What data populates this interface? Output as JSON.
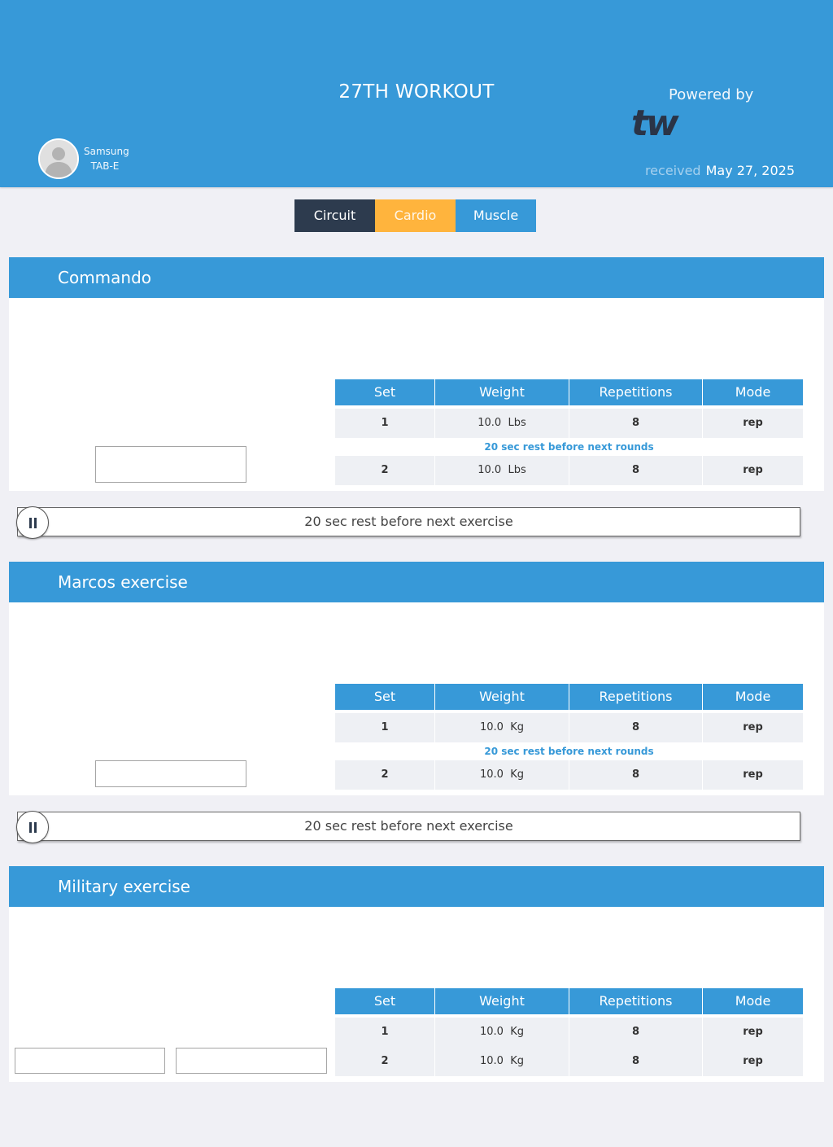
{
  "header": {
    "title": "27TH WORKOUT",
    "device_line1": "Samsung",
    "device_line2": "TAB-E",
    "powered_by": "Powered by",
    "logo_text": "tw",
    "received_label": "received",
    "received_date": "May 27, 2025"
  },
  "tabs": [
    {
      "label": "Circuit",
      "color": "#2d3b4e"
    },
    {
      "label": "Cardio",
      "color": "#ffb43d"
    },
    {
      "label": "Muscle",
      "color": "#3799d8"
    }
  ],
  "table_headers": [
    "Set",
    "Weight",
    "Repetitions",
    "Mode"
  ],
  "exercises": [
    {
      "name": "Commando",
      "rows": [
        {
          "set": "1",
          "weight": "10.0",
          "unit": "Lbs",
          "reps": "8",
          "mode": "rep"
        },
        {
          "set": "2",
          "weight": "10.0",
          "unit": "Lbs",
          "reps": "8",
          "mode": "rep"
        }
      ],
      "round_rest": "20 sec rest before next rounds",
      "exercise_rest": "20 sec rest before next exercise"
    },
    {
      "name": "Marcos exercise",
      "rows": [
        {
          "set": "1",
          "weight": "10.0",
          "unit": "Kg",
          "reps": "8",
          "mode": "rep"
        },
        {
          "set": "2",
          "weight": "10.0",
          "unit": "Kg",
          "reps": "8",
          "mode": "rep"
        }
      ],
      "round_rest": "20 sec rest before next rounds",
      "exercise_rest": "20 sec rest before next exercise"
    },
    {
      "name": "Military exercise",
      "rows": [
        {
          "set": "1",
          "weight": "10.0",
          "unit": "Kg",
          "reps": "8",
          "mode": "rep"
        },
        {
          "set": "2",
          "weight": "10.0",
          "unit": "Kg",
          "reps": "8",
          "mode": "rep"
        }
      ]
    }
  ],
  "colors": {
    "primary": "#3799d8",
    "dark": "#2d3b4e",
    "accent": "#ffb43d",
    "background": "#f0f0f5"
  }
}
